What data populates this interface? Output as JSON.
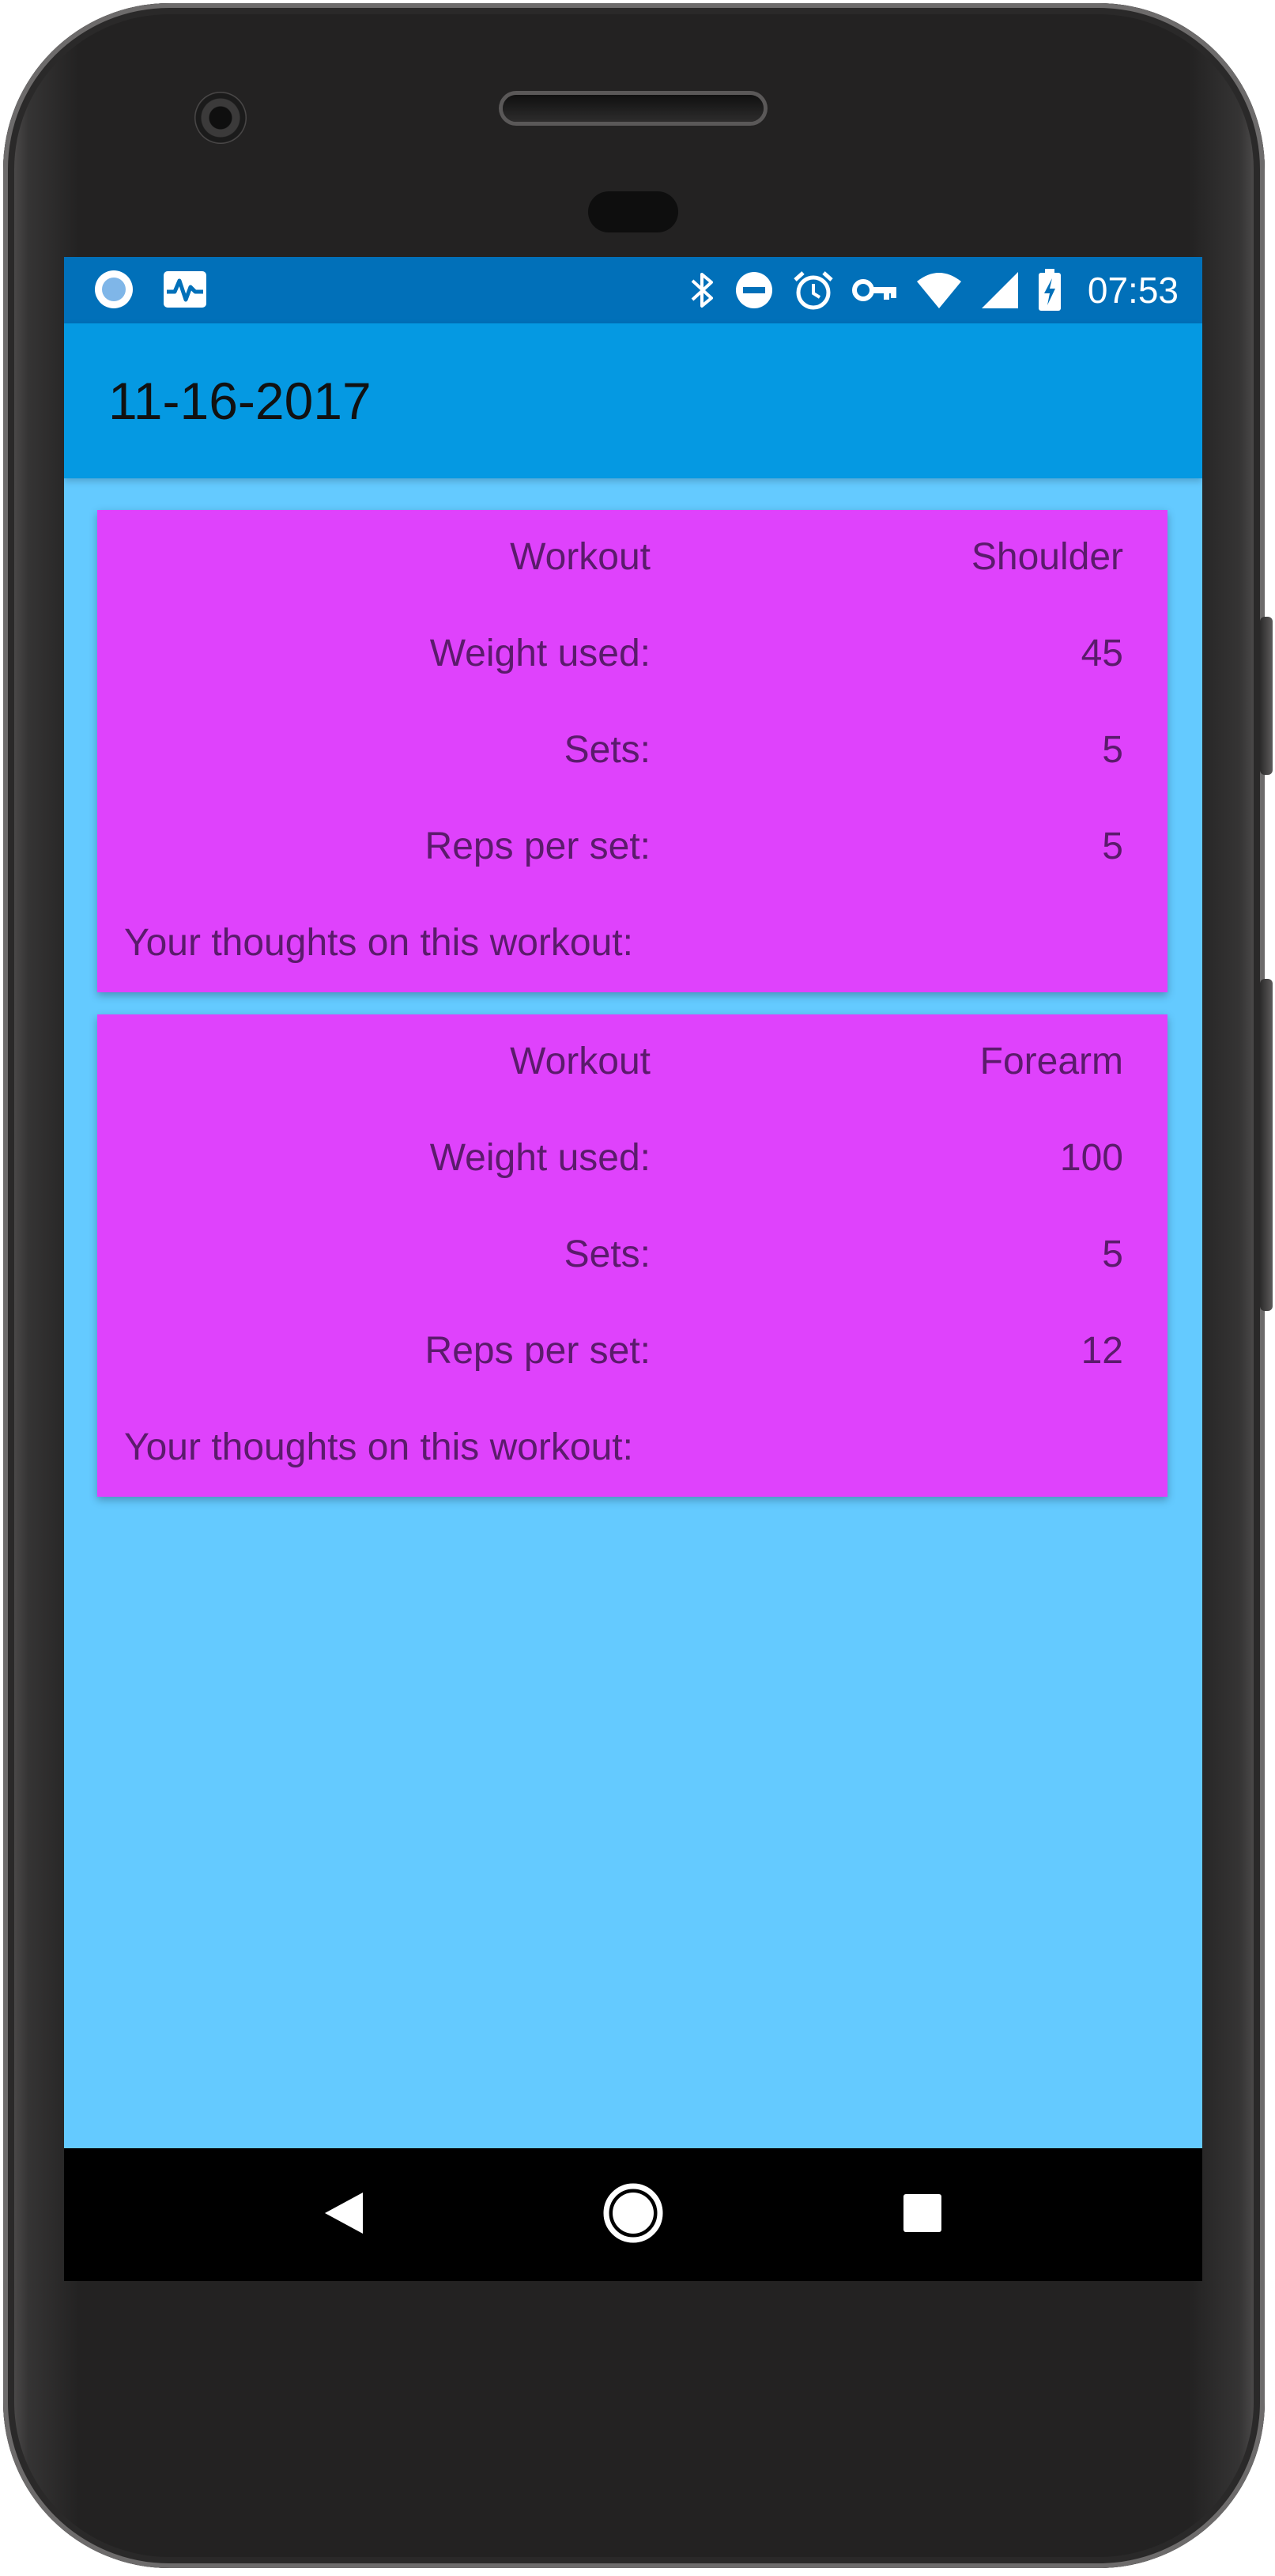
{
  "status_bar": {
    "time": "07:53",
    "left_icons": [
      "app-circle-icon",
      "pulse-monitor-icon"
    ],
    "right_icons": [
      "bluetooth-icon",
      "do-not-disturb-icon",
      "alarm-icon",
      "vpn-key-icon",
      "wifi-icon",
      "cell-signal-icon",
      "battery-charging-icon"
    ]
  },
  "app_bar": {
    "title": "11-16-2017"
  },
  "workouts": [
    {
      "workout_label": "Workout",
      "workout_value": "Shoulder",
      "weight_label": "Weight used:",
      "weight_value": "45",
      "sets_label": "Sets:",
      "sets_value": "5",
      "reps_label": "Reps per set:",
      "reps_value": "5",
      "thoughts_label": "Your thoughts on this workout:"
    },
    {
      "workout_label": "Workout",
      "workout_value": "Forearm",
      "weight_label": "Weight used:",
      "weight_value": "100",
      "sets_label": "Sets:",
      "sets_value": "5",
      "reps_label": "Reps per set:",
      "reps_value": "12",
      "thoughts_label": "Your thoughts on this workout:"
    }
  ],
  "nav_bar": {
    "buttons": [
      "back-icon",
      "home-icon",
      "recents-icon"
    ]
  },
  "colors": {
    "status_bar": "#0170b9",
    "app_bar": "#0599e2",
    "background": "#64caff",
    "card": "#df42fc",
    "card_text": "#5b1b6c",
    "nav_bar": "#000000"
  }
}
